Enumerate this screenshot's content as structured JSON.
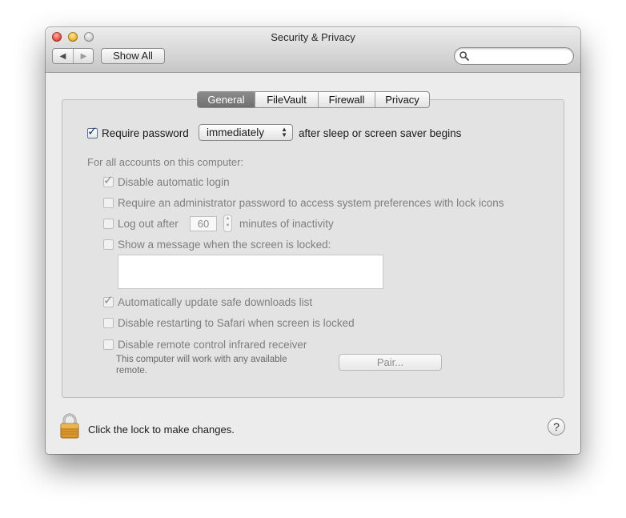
{
  "window": {
    "title": "Security & Privacy"
  },
  "toolbar": {
    "back_icon": "◀",
    "forward_icon": "▶",
    "show_all_label": "Show All",
    "search_value": "",
    "search_placeholder": ""
  },
  "tabs": [
    {
      "label": "General",
      "selected": true
    },
    {
      "label": "FileVault",
      "selected": false
    },
    {
      "label": "Firewall",
      "selected": false
    },
    {
      "label": "Privacy",
      "selected": false
    }
  ],
  "general": {
    "require_password": {
      "label": "Require password",
      "checked": true,
      "popup_value": "immediately",
      "suffix": "after sleep or screen saver begins"
    },
    "section_label": "For all accounts on this computer:",
    "options": {
      "disable_auto_login": {
        "label": "Disable automatic login",
        "checked": true
      },
      "require_admin": {
        "label": "Require an administrator password to access system preferences with lock icons",
        "checked": false
      },
      "log_out": {
        "label_prefix": "Log out after",
        "minutes_value": "60",
        "label_suffix": "minutes of inactivity",
        "checked": false
      },
      "show_message": {
        "label": "Show a message when the screen is locked:",
        "checked": false,
        "message_value": ""
      },
      "auto_update_downloads": {
        "label": "Automatically update safe downloads list",
        "checked": true
      },
      "disable_safari_restart": {
        "label": "Disable restarting to Safari when screen is locked",
        "checked": false
      },
      "disable_ir": {
        "label": "Disable remote control infrared receiver",
        "checked": false
      }
    },
    "ir_note": "This computer will work with any available remote.",
    "pair_label": "Pair..."
  },
  "footer": {
    "lock_text": "Click the lock to make changes.",
    "help_label": "?"
  },
  "colors": {
    "tab_selected": "#7a7a7a",
    "lock_gold": "#d9962a"
  }
}
